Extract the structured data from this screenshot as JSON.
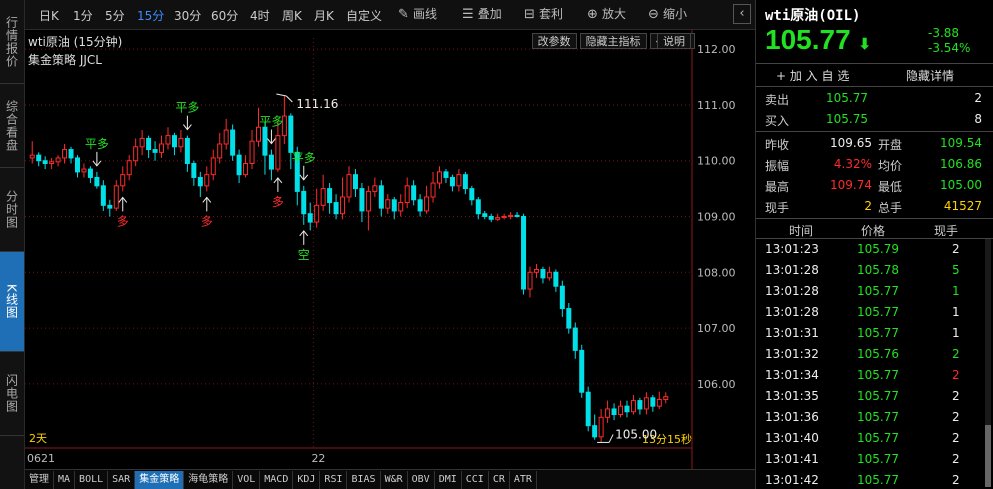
{
  "colors": {
    "up": "#ff2b2b",
    "down": "#00e0e8",
    "bg": "#000000",
    "grid": "#7a0f0f",
    "accent": "#1f6fb6",
    "green": "#22e022",
    "yellow": "#ffd100"
  },
  "left_tabs": [
    "行情报价",
    "综合看盘",
    "分时图",
    "K线图",
    "闪电图"
  ],
  "toolbar": {
    "periods": [
      "日K",
      "1分",
      "5分",
      "15分",
      "30分",
      "60分",
      "4时",
      "周K",
      "月K",
      "自定义"
    ],
    "active_period": "15分",
    "draw": "画线",
    "overlay": "叠加",
    "arb": "套利",
    "zoom_in": "放大",
    "zoom_out": "缩小",
    "collapse": "‹"
  },
  "chart_head": {
    "title": "wti原油 (15分钟)",
    "strategy": "集金策略 JJCL",
    "btn_params": "改参数",
    "btn_hide": "隐藏主指标",
    "btn_left": "←",
    "btn_right": "→",
    "btn_help": "说明"
  },
  "chart_data": {
    "type": "candlestick",
    "ylim": [
      104.85,
      112.2
    ],
    "y_ticks": [
      "112.00",
      "111.00",
      "110.00",
      "109.00",
      "108.00",
      "107.00",
      "106.00"
    ],
    "x_labels": [
      "0621",
      "22"
    ],
    "range_label": "2天",
    "time_label": "13分15秒",
    "high_label": "111.16",
    "low_label": "105.00",
    "candles": [
      [
        110.05,
        110.1,
        110.35,
        109.95
      ],
      [
        110.1,
        110.0,
        110.15,
        109.9
      ],
      [
        110.0,
        109.95,
        110.08,
        109.85
      ],
      [
        109.95,
        109.98,
        110.05,
        109.85
      ],
      [
        109.98,
        110.05,
        110.1,
        109.9
      ],
      [
        110.05,
        110.2,
        110.3,
        109.95
      ],
      [
        110.2,
        110.05,
        110.25,
        109.95
      ],
      [
        110.05,
        109.8,
        110.1,
        109.7
      ],
      [
        109.8,
        109.85,
        109.95,
        109.7
      ],
      [
        109.85,
        109.7,
        109.9,
        109.6
      ],
      [
        109.7,
        109.55,
        109.8,
        109.5
      ],
      [
        109.55,
        109.2,
        109.65,
        109.1
      ],
      [
        109.2,
        109.15,
        109.3,
        109.0
      ],
      [
        109.15,
        109.55,
        109.65,
        109.1
      ],
      [
        109.55,
        109.75,
        109.9,
        109.45
      ],
      [
        109.75,
        110.0,
        110.1,
        109.65
      ],
      [
        110.0,
        110.25,
        110.4,
        109.9
      ],
      [
        110.25,
        110.4,
        110.55,
        110.1
      ],
      [
        110.4,
        110.2,
        110.45,
        110.05
      ],
      [
        110.2,
        110.15,
        110.35,
        110.0
      ],
      [
        110.15,
        110.3,
        110.45,
        110.05
      ],
      [
        110.3,
        110.45,
        110.6,
        110.2
      ],
      [
        110.45,
        110.25,
        110.5,
        110.1
      ],
      [
        110.25,
        110.4,
        110.55,
        110.15
      ],
      [
        110.4,
        109.95,
        110.45,
        109.8
      ],
      [
        109.95,
        109.7,
        110.0,
        109.55
      ],
      [
        109.7,
        109.55,
        109.8,
        109.35
      ],
      [
        109.55,
        109.75,
        109.9,
        109.45
      ],
      [
        109.75,
        110.05,
        110.2,
        109.65
      ],
      [
        110.05,
        110.3,
        110.5,
        109.95
      ],
      [
        110.3,
        110.55,
        110.75,
        110.2
      ],
      [
        110.55,
        110.1,
        110.65,
        110.0
      ],
      [
        110.1,
        109.75,
        110.2,
        109.6
      ],
      [
        109.75,
        109.95,
        110.1,
        109.7
      ],
      [
        109.95,
        110.35,
        110.55,
        109.85
      ],
      [
        110.35,
        110.6,
        110.95,
        110.25
      ],
      [
        110.6,
        110.1,
        110.7,
        109.75
      ],
      [
        110.1,
        109.85,
        110.2,
        109.65
      ],
      [
        109.85,
        110.45,
        110.7,
        109.8
      ],
      [
        110.45,
        110.8,
        111.16,
        110.3
      ],
      [
        110.8,
        110.15,
        110.85,
        109.85
      ],
      [
        110.15,
        109.45,
        110.25,
        109.2
      ],
      [
        109.45,
        109.05,
        109.55,
        108.85
      ],
      [
        109.05,
        108.9,
        109.25,
        108.75
      ],
      [
        108.9,
        109.2,
        109.5,
        108.8
      ],
      [
        109.2,
        109.5,
        109.75,
        109.1
      ],
      [
        109.5,
        109.25,
        109.6,
        109.05
      ],
      [
        109.25,
        109.05,
        109.4,
        108.95
      ],
      [
        109.05,
        109.35,
        109.7,
        108.95
      ],
      [
        109.35,
        109.75,
        109.9,
        109.25
      ],
      [
        109.75,
        109.5,
        109.85,
        109.35
      ],
      [
        109.5,
        109.1,
        109.6,
        108.9
      ],
      [
        109.1,
        109.45,
        109.55,
        108.75
      ],
      [
        109.45,
        109.55,
        109.7,
        109.35
      ],
      [
        109.55,
        109.15,
        109.65,
        109.0
      ],
      [
        109.15,
        109.3,
        109.4,
        109.05
      ],
      [
        109.3,
        109.1,
        109.35,
        108.95
      ],
      [
        109.1,
        109.25,
        109.4,
        109.0
      ],
      [
        109.25,
        109.55,
        109.7,
        109.15
      ],
      [
        109.55,
        109.3,
        109.65,
        109.2
      ],
      [
        109.3,
        109.1,
        109.4,
        109.0
      ],
      [
        109.1,
        109.35,
        109.55,
        109.05
      ],
      [
        109.35,
        109.6,
        109.8,
        109.25
      ],
      [
        109.6,
        109.8,
        109.9,
        109.5
      ],
      [
        109.8,
        109.7,
        109.85,
        109.6
      ],
      [
        109.7,
        109.55,
        109.75,
        109.45
      ],
      [
        109.55,
        109.75,
        109.85,
        109.45
      ],
      [
        109.75,
        109.5,
        109.8,
        109.4
      ],
      [
        109.5,
        109.3,
        109.55,
        109.2
      ],
      [
        109.3,
        109.05,
        109.35,
        108.95
      ],
      [
        109.05,
        109.0,
        109.1,
        108.95
      ],
      [
        109.0,
        108.95,
        109.05,
        108.9
      ],
      [
        108.95,
        108.98,
        109.05,
        108.92
      ],
      [
        108.98,
        109.0,
        109.05,
        108.95
      ],
      [
        109.0,
        109.02,
        109.08,
        108.95
      ],
      [
        109.02,
        109.0,
        109.08,
        108.98
      ],
      [
        109.0,
        107.7,
        109.05,
        107.6
      ],
      [
        107.7,
        108.0,
        108.1,
        107.55
      ],
      [
        108.0,
        108.05,
        108.15,
        107.9
      ],
      [
        108.05,
        107.9,
        108.1,
        107.8
      ],
      [
        107.9,
        108.0,
        108.1,
        107.85
      ],
      [
        108.0,
        107.75,
        108.05,
        107.65
      ],
      [
        107.75,
        107.35,
        107.85,
        107.2
      ],
      [
        107.35,
        107.0,
        107.45,
        106.9
      ],
      [
        107.0,
        106.6,
        107.1,
        106.45
      ],
      [
        106.6,
        105.85,
        106.7,
        105.75
      ],
      [
        105.85,
        105.25,
        105.95,
        105.15
      ],
      [
        105.25,
        105.05,
        105.45,
        105.0
      ],
      [
        105.05,
        105.4,
        105.55,
        104.95
      ],
      [
        105.4,
        105.55,
        105.7,
        105.3
      ],
      [
        105.55,
        105.45,
        105.65,
        105.35
      ],
      [
        105.45,
        105.6,
        105.7,
        105.4
      ],
      [
        105.6,
        105.5,
        105.7,
        105.4
      ],
      [
        105.5,
        105.7,
        105.8,
        105.45
      ],
      [
        105.7,
        105.55,
        105.75,
        105.45
      ],
      [
        105.55,
        105.75,
        105.85,
        105.45
      ],
      [
        105.75,
        105.6,
        105.8,
        105.5
      ],
      [
        105.6,
        105.72,
        105.86,
        105.55
      ],
      [
        105.72,
        105.77,
        105.85,
        105.65
      ]
    ],
    "signals": [
      {
        "label": "平多",
        "idx": 10,
        "above": true,
        "color": "#22e022"
      },
      {
        "label": "多",
        "idx": 14,
        "above": false,
        "color": "#ff2b2b"
      },
      {
        "label": "平多",
        "idx": 24,
        "above": true,
        "color": "#22e022"
      },
      {
        "label": "多",
        "idx": 27,
        "above": false,
        "color": "#ff2b2b"
      },
      {
        "label": "平多",
        "idx": 37,
        "above": true,
        "color": "#22e022"
      },
      {
        "label": "多",
        "idx": 38,
        "above": false,
        "color": "#ff2b2b"
      },
      {
        "label": "平多",
        "idx": 42,
        "above": true,
        "color": "#22e022"
      },
      {
        "label": "空",
        "idx": 42,
        "above": false,
        "color": "#22e022"
      }
    ]
  },
  "quote": {
    "name": "wti原油(OIL)",
    "price": "105.77",
    "arrow": "⬇",
    "change": "-3.88",
    "change_pct": "-3.54%",
    "add_watch": "+ 加 入 自 选",
    "hide_detail": "隐藏详情",
    "sell_label": "卖出",
    "sell_price": "105.77",
    "sell_vol": "2",
    "buy_label": "买入",
    "buy_price": "105.75",
    "buy_vol": "8",
    "stats": [
      {
        "l1": "昨收",
        "v1": "109.65",
        "c1": "white",
        "l2": "开盘",
        "v2": "109.54",
        "c2": "green"
      },
      {
        "l1": "振幅",
        "v1": "4.32%",
        "c1": "red",
        "l2": "均价",
        "v2": "106.86",
        "c2": "green"
      },
      {
        "l1": "最高",
        "v1": "109.74",
        "c1": "red",
        "l2": "最低",
        "v2": "105.00",
        "c2": "green"
      },
      {
        "l1": "现手",
        "v1": "2",
        "c1": "yellow",
        "l2": "总手",
        "v2": "41527",
        "c2": "yellow"
      }
    ],
    "tick_headers": [
      "时间",
      "价格",
      "现手"
    ],
    "ticks": [
      {
        "t": "13:01:23",
        "p": "105.79",
        "v": "2",
        "vc": "white"
      },
      {
        "t": "13:01:28",
        "p": "105.78",
        "v": "5",
        "vc": "green"
      },
      {
        "t": "13:01:28",
        "p": "105.77",
        "v": "1",
        "vc": "green"
      },
      {
        "t": "13:01:28",
        "p": "105.77",
        "v": "1",
        "vc": "white"
      },
      {
        "t": "13:01:31",
        "p": "105.77",
        "v": "1",
        "vc": "white"
      },
      {
        "t": "13:01:32",
        "p": "105.76",
        "v": "2",
        "vc": "green"
      },
      {
        "t": "13:01:34",
        "p": "105.77",
        "v": "2",
        "vc": "red"
      },
      {
        "t": "13:01:35",
        "p": "105.77",
        "v": "2",
        "vc": "white"
      },
      {
        "t": "13:01:36",
        "p": "105.77",
        "v": "2",
        "vc": "white"
      },
      {
        "t": "13:01:40",
        "p": "105.77",
        "v": "2",
        "vc": "white"
      },
      {
        "t": "13:01:41",
        "p": "105.77",
        "v": "2",
        "vc": "white"
      },
      {
        "t": "13:01:42",
        "p": "105.77",
        "v": "2",
        "vc": "white"
      }
    ]
  },
  "bottom_tabs": [
    "管理",
    "MA",
    "BOLL",
    "SAR",
    "集金策略",
    "海龟策略",
    "VOL",
    "MACD",
    "KDJ",
    "RSI",
    "BIAS",
    "W&R",
    "OBV",
    "DMI",
    "CCI",
    "CR",
    "ATR"
  ],
  "bottom_active": "集金策略"
}
